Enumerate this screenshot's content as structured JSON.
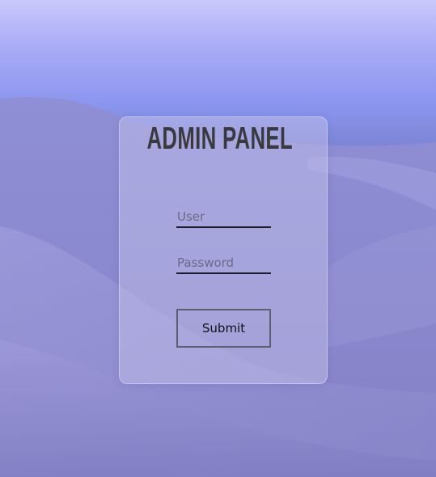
{
  "login": {
    "title": "ADMIN PANEL",
    "user_placeholder": "User",
    "password_placeholder": "Password",
    "submit_label": "Submit"
  },
  "colors": {
    "sky_top": "#c9c8fb",
    "sky_bottom": "#7e86d6",
    "dunes": "#8b88cf",
    "title": "#3a3a3e",
    "underline": "#1c1c28",
    "button_border": "#5f5d72"
  }
}
